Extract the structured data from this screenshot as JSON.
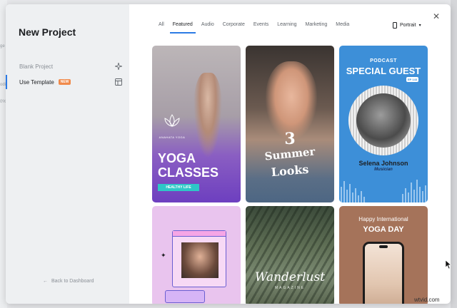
{
  "background": {
    "fragments": [
      "ge",
      "odi",
      "0%"
    ]
  },
  "sidebar": {
    "title": "New Project",
    "items": [
      {
        "label": "Blank Project",
        "icon": "sparkle-icon"
      },
      {
        "label": "Use Template",
        "badge": "NEW",
        "icon": "layout-icon"
      }
    ],
    "back_label": "Back to Dashboard"
  },
  "tabs": [
    "All",
    "Featured",
    "Audio",
    "Corporate",
    "Events",
    "Learning",
    "Marketing",
    "Media"
  ],
  "active_tab": "Featured",
  "orientation": {
    "label": "Portrait"
  },
  "templates": {
    "yoga": {
      "brand": "ANAHATA YOGA",
      "title_line1": "YOGA",
      "title_line2": "CLASSES",
      "tag": "HEALTHY LIFE"
    },
    "summer": {
      "number": "3",
      "line1": "Summer",
      "line2": "Looks"
    },
    "podcast": {
      "kicker": "PODCAST",
      "title": "SPECIAL GUEST",
      "episode": "EP 143",
      "name": "Selena Johnson",
      "role": "Musician"
    },
    "wanderlust": {
      "title": "Wanderlust",
      "subtitle": "MAGAZINE"
    },
    "yogaday": {
      "line1": "Happy International",
      "line2": "YOGA DAY"
    }
  },
  "watermark": "wtvid.com",
  "colors": {
    "accent": "#2c7be5",
    "badge": "#f08a4b",
    "sidebar_bg": "#eef0f2"
  }
}
